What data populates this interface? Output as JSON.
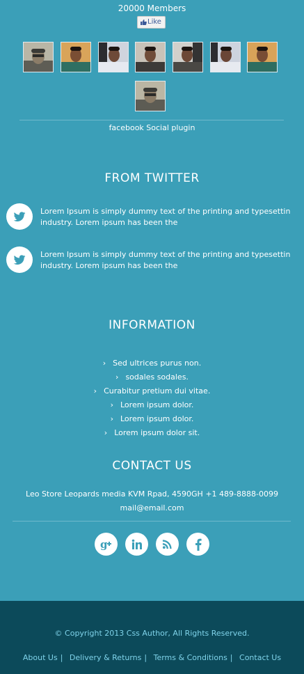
{
  "facebook": {
    "members": "20000 Members",
    "like_label": "Like",
    "plugin_label": "facebook Social plugin",
    "avatar_count": 8
  },
  "twitter": {
    "title": "FROM TWITTER",
    "tweets": [
      {
        "text": "Lorem Ipsum is simply dummy text of the printing and typesettin industry. Lorem ipsum has been the"
      },
      {
        "text": "Lorem Ipsum is simply dummy text of the printing and typesettin industry. Lorem ipsum has been the"
      }
    ]
  },
  "information": {
    "title": "INFORMATION",
    "items": [
      "Sed ultrices purus non.",
      "sodales sodales.",
      "Curabitur pretium dui vitae.",
      "Lorem ipsum dolor.",
      "Lorem ipsum dolor.",
      "Lorem ipsum dolor sit."
    ]
  },
  "contact": {
    "title": "CONTACT US",
    "address": "Leo Store Leopards media KVM Rpad, 4590GH +1 489-8888-0099",
    "email": "mail@email.com"
  },
  "social_icons": [
    "google-plus-icon",
    "linkedin-icon",
    "rss-icon",
    "facebook-icon"
  ],
  "footer": {
    "copyright": "© Copyright 2013 Css Author, All Rights Reserved.",
    "links": [
      "About Us",
      "Delivery & Returns",
      "Terms & Conditions",
      "Contact Us"
    ]
  },
  "colors": {
    "background": "#3b9fb8",
    "footer": "#0c4a5a",
    "footer_text": "#7fd3ea"
  }
}
